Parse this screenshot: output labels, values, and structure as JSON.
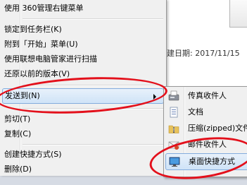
{
  "background_window": {
    "date_text": "建日期: 2017/11/15"
  },
  "context_menu": {
    "items": [
      {
        "label": "使用 360管理右键菜单"
      },
      {
        "label": "锁定到任务栏(K)"
      },
      {
        "label": "附到「开始」菜单(U)"
      },
      {
        "label": "使用联想电脑管家进行扫描"
      },
      {
        "label": "还原以前的版本(V)"
      },
      {
        "label": "发送到(N)"
      },
      {
        "label": "剪切(T)"
      },
      {
        "label": "复制(C)"
      },
      {
        "label": "创建快捷方式(S)"
      },
      {
        "label": "删除(D)"
      }
    ]
  },
  "send_to_submenu": {
    "items": [
      {
        "label": "传真收件人",
        "icon": "fax-icon"
      },
      {
        "label": "文档",
        "icon": "documents-folder-icon"
      },
      {
        "label": "压缩(zipped)文件夹",
        "icon": "zip-folder-icon"
      },
      {
        "label": "邮件收件人",
        "icon": "mail-recipient-icon"
      },
      {
        "label": "桌面快捷方式",
        "icon": "desktop-icon"
      }
    ]
  },
  "annotations": {
    "highlight_color": "#e3101b"
  }
}
